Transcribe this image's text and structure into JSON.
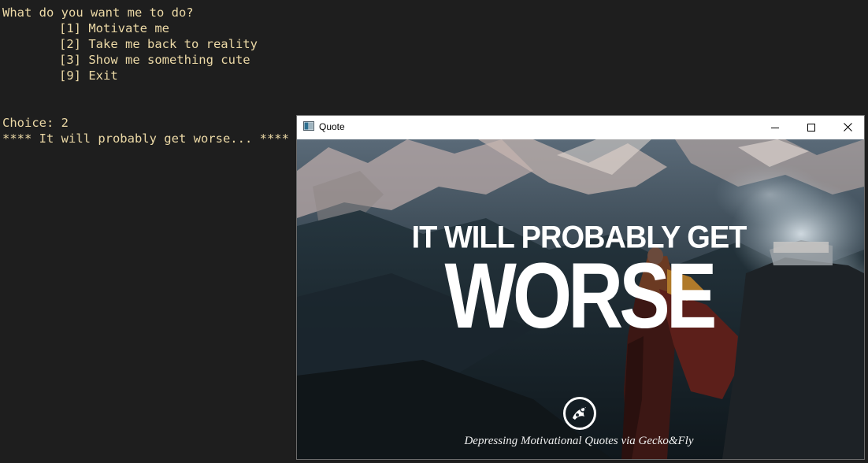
{
  "terminal": {
    "prompt": "What do you want me to do?",
    "options": [
      "[1] Motivate me",
      "[2] Take me back to reality",
      "[3] Show me something cute",
      "[9] Exit"
    ],
    "choice_line": "Choice: 2",
    "result_line": "**** It will probably get worse... ****",
    "text_color": "#ecd9a6",
    "background": "#1e1e1e"
  },
  "window": {
    "title": "Quote",
    "controls": {
      "minimize_icon": "minimize-icon",
      "maximize_icon": "maximize-icon",
      "close_icon": "close-icon"
    }
  },
  "image": {
    "line1": "IT WILL PROBABLY GET",
    "line2": "WORSE",
    "credit": "Depressing Motivational Quotes via Gecko&Fly",
    "logo_icon": "gecko-fly-logo-icon"
  }
}
